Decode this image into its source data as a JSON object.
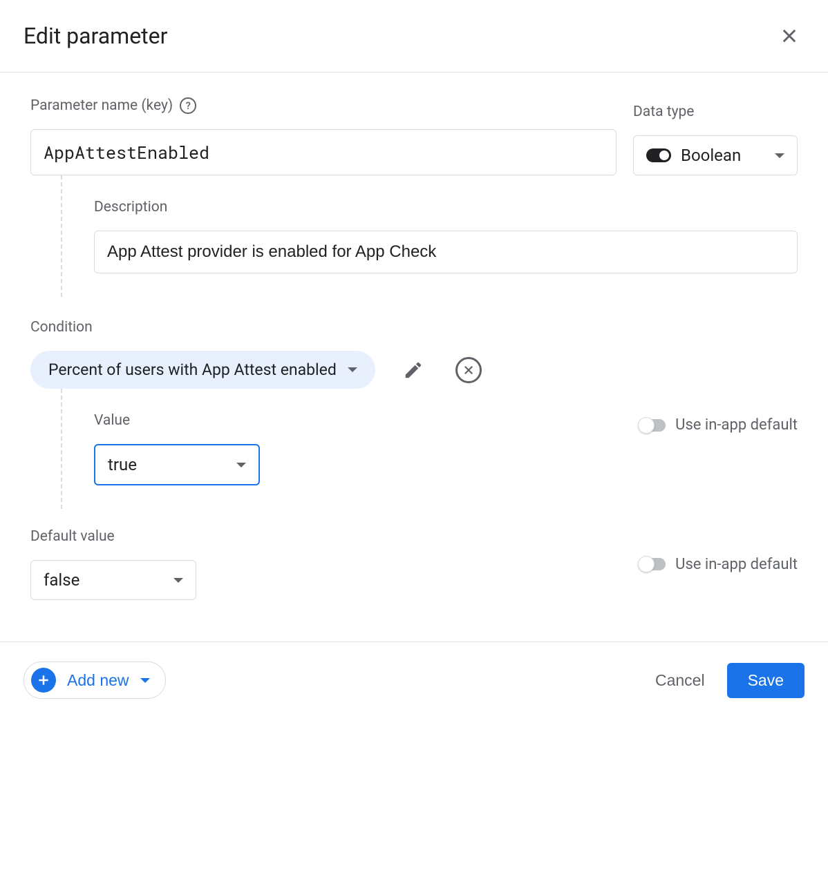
{
  "header": {
    "title": "Edit parameter"
  },
  "param": {
    "name_label": "Parameter name (key)",
    "name_value": "AppAttestEnabled",
    "type_label": "Data type",
    "type_value": "Boolean"
  },
  "description": {
    "label": "Description",
    "value": "App Attest provider is enabled for App Check"
  },
  "condition": {
    "label": "Condition",
    "chip_text": "Percent of users with App Attest enabled",
    "value_label": "Value",
    "value_selected": "true",
    "use_default_label": "Use in-app default"
  },
  "default_value": {
    "label": "Default value",
    "selected": "false",
    "use_default_label": "Use in-app default"
  },
  "footer": {
    "add_new": "Add new",
    "cancel": "Cancel",
    "save": "Save"
  }
}
